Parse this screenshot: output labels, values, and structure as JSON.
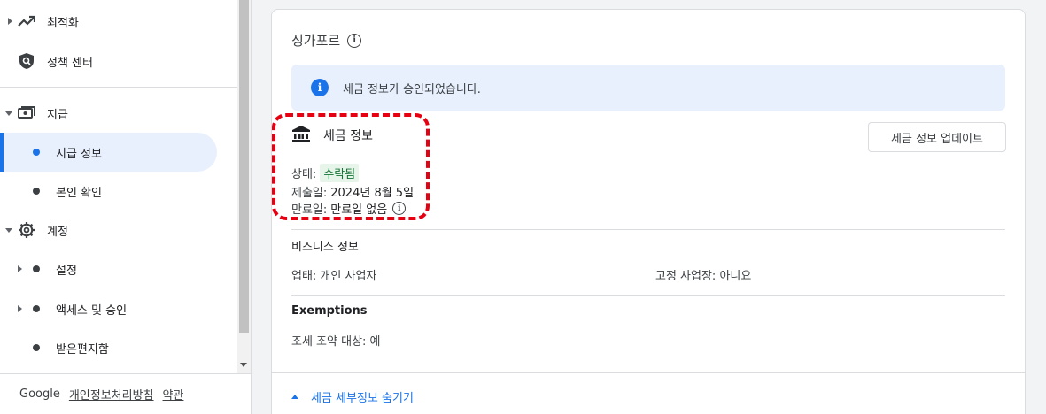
{
  "sidebar": {
    "items": [
      {
        "label": "최적화",
        "icon": "trending-up-icon"
      },
      {
        "label": "정책 센터",
        "icon": "policy-shield-icon"
      },
      {
        "label": "지급",
        "icon": "payments-icon"
      },
      {
        "label": "지급 정보"
      },
      {
        "label": "본인 확인"
      },
      {
        "label": "계정",
        "icon": "gear-icon"
      },
      {
        "label": "설정"
      },
      {
        "label": "액세스 및 승인"
      },
      {
        "label": "받은편지함"
      }
    ],
    "active_item": "지급 정보"
  },
  "footer": {
    "brand": "Google",
    "privacy_link": "개인정보처리방침",
    "terms_link": "약관"
  },
  "main": {
    "country": "싱가포르",
    "banner_text": "세금 정보가 승인되었습니다.",
    "tax_info": {
      "title": "세금 정보",
      "status_label": "상태:",
      "status_value": "수락됨",
      "submitted_label": "제출일:",
      "submitted_value": "2024년 8월 5일",
      "expiry_label": "만료일:",
      "expiry_value": "만료일 없음"
    },
    "update_button": "세금 정보 업데이트",
    "business": {
      "title": "비즈니스 정보",
      "type_text": "업태: 개인 사업자",
      "fixed_place_text": "고정 사업장: 아니요"
    },
    "exemptions": {
      "title": "Exemptions",
      "treaty_text": "조세 조약 대상: 예"
    },
    "toggle_details": "세금 세부정보 숨기기"
  },
  "colors": {
    "accent": "#1a73e8",
    "banner_bg": "#e8f0fe",
    "status_bg": "#e6f4ea",
    "status_text": "#137333",
    "highlight": "#e60012"
  }
}
